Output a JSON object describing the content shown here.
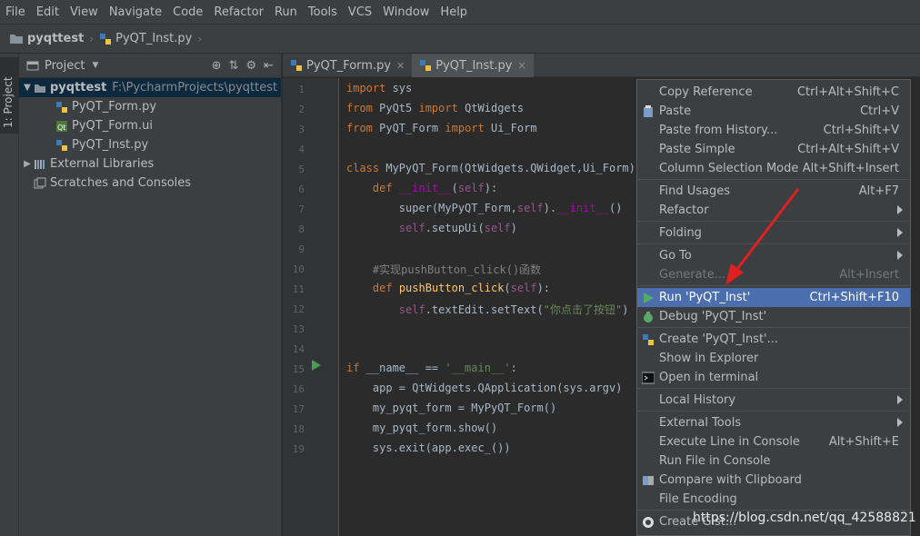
{
  "menubar": [
    "File",
    "Edit",
    "View",
    "Navigate",
    "Code",
    "Refactor",
    "Run",
    "Tools",
    "VCS",
    "Window",
    "Help"
  ],
  "navbar": {
    "project": "pyqttest",
    "file": "PyQT_Inst.py"
  },
  "toolstrip": {
    "tab_label": "1: Project"
  },
  "project_panel": {
    "title": "Project",
    "root": {
      "name": "pyqttest",
      "path": "F:\\PycharmProjects\\pyqttest"
    },
    "files": [
      "PyQT_Form.py",
      "PyQT_Form.ui",
      "PyQT_Inst.py"
    ],
    "external": "External Libraries",
    "scratches": "Scratches and Consoles"
  },
  "editor": {
    "tabs": [
      {
        "label": "PyQT_Form.py",
        "active": false
      },
      {
        "label": "PyQT_Inst.py",
        "active": true
      }
    ],
    "line_numbers": [
      "1",
      "2",
      "3",
      "4",
      "5",
      "6",
      "7",
      "8",
      "9",
      "10",
      "11",
      "12",
      "13",
      "14",
      "15",
      "16",
      "17",
      "18",
      "19"
    ]
  },
  "context_menu": {
    "items": [
      {
        "label": "Copy Reference",
        "shortcut": "Ctrl+Alt+Shift+C"
      },
      {
        "label": "Paste",
        "shortcut": "Ctrl+V",
        "icon": "paste-icon"
      },
      {
        "label": "Paste from History...",
        "shortcut": "Ctrl+Shift+V"
      },
      {
        "label": "Paste Simple",
        "shortcut": "Ctrl+Alt+Shift+V"
      },
      {
        "label": "Column Selection Mode",
        "shortcut": "Alt+Shift+Insert"
      },
      {
        "label": "Find Usages",
        "shortcut": "Alt+F7"
      },
      {
        "label": "Refactor",
        "submenu": true
      },
      {
        "label": "Folding",
        "submenu": true
      },
      {
        "label": "Go To",
        "submenu": true
      },
      {
        "label": "Generate...",
        "shortcut": "Alt+Insert",
        "disabled": true
      },
      {
        "label": "Run 'PyQT_Inst'",
        "shortcut": "Ctrl+Shift+F10",
        "highlighted": true,
        "icon": "run-icon"
      },
      {
        "label": "Debug 'PyQT_Inst'",
        "icon": "debug-icon"
      },
      {
        "label": "Create 'PyQT_Inst'...",
        "icon": "python-icon"
      },
      {
        "label": "Show in Explorer"
      },
      {
        "label": "Open in terminal",
        "icon": "terminal-icon"
      },
      {
        "label": "Local History",
        "submenu": true
      },
      {
        "label": "External Tools",
        "submenu": true
      },
      {
        "label": "Execute Line in Console",
        "shortcut": "Alt+Shift+E"
      },
      {
        "label": "Run File in Console"
      },
      {
        "label": "Compare with Clipboard",
        "icon": "compare-icon"
      },
      {
        "label": "File Encoding"
      },
      {
        "label": "Create Gist...",
        "icon": "github-icon"
      }
    ]
  },
  "watermark": "https://blog.csdn.net/qq_42588821",
  "colors": {
    "highlight": "#4b6eaf",
    "background": "#2b2b2b",
    "panel": "#3c3f41",
    "keyword": "#cc7832",
    "string": "#6a8759"
  }
}
